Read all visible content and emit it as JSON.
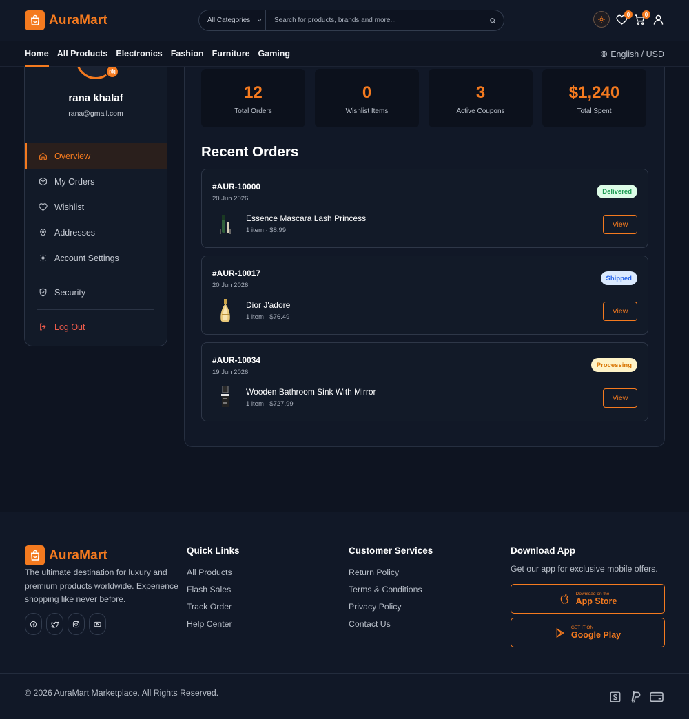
{
  "brand": {
    "name": "AuraMart",
    "accent": "#f47a1f"
  },
  "header": {
    "search": {
      "category": "All Categories",
      "placeholder": "Search for products, brands and more..."
    },
    "wishlist_count": "0",
    "cart_count": "0"
  },
  "nav": {
    "items": [
      "Home",
      "All Products",
      "Electronics",
      "Fashion",
      "Furniture",
      "Gaming"
    ],
    "active": "Home",
    "language": "English / USD"
  },
  "profile": {
    "name": "rana khalaf",
    "email": "rana@gmail.com",
    "menu": [
      "Overview",
      "My Orders",
      "Wishlist",
      "Addresses",
      "Account Settings",
      "Security",
      "Log Out"
    ],
    "active": "Overview"
  },
  "stats": [
    {
      "value": "12",
      "label": "Total Orders"
    },
    {
      "value": "0",
      "label": "Wishlist Items"
    },
    {
      "value": "3",
      "label": "Active Coupons"
    },
    {
      "value": "$1,240",
      "label": "Total Spent"
    }
  ],
  "recent_orders": {
    "title": "Recent Orders",
    "orders": [
      {
        "id": "#AUR-10000",
        "date": "20 Jun 2026",
        "status": "Delivered",
        "status_color": "#1f9d55",
        "status_bg": "#dcfce7",
        "product": "Essence Mascara Lash Princess",
        "meta": "1 item · $8.99",
        "action": "View"
      },
      {
        "id": "#AUR-10017",
        "date": "20 Jun 2026",
        "status": "Shipped",
        "status_color": "#2563eb",
        "status_bg": "#dbeafe",
        "product": "Dior J'adore",
        "meta": "1 item · $76.49",
        "action": "View"
      },
      {
        "id": "#AUR-10034",
        "date": "19 Jun 2026",
        "status": "Processing",
        "status_color": "#d97706",
        "status_bg": "#fef3c7",
        "product": "Wooden Bathroom Sink With Mirror",
        "meta": "1 item · $727.99",
        "action": "View"
      }
    ]
  },
  "footer": {
    "description": "The ultimate destination for luxury and premium products worldwide. Experience shopping like never before.",
    "quick_links": {
      "title": "Quick Links",
      "items": [
        "All Products",
        "Flash Sales",
        "Track Order",
        "Help Center"
      ]
    },
    "customer_services": {
      "title": "Customer Services",
      "items": [
        "Return Policy",
        "Terms & Conditions",
        "Privacy Policy",
        "Contact Us"
      ]
    },
    "download": {
      "title": "Download App",
      "text": "Get our app for exclusive mobile offers.",
      "app_store_small": "Download on the",
      "app_store_big": "App Store",
      "play_small": "GET IT ON",
      "play_big": "Google Play"
    },
    "copyright": "© 2026 AuraMart Marketplace. All Rights Reserved."
  }
}
